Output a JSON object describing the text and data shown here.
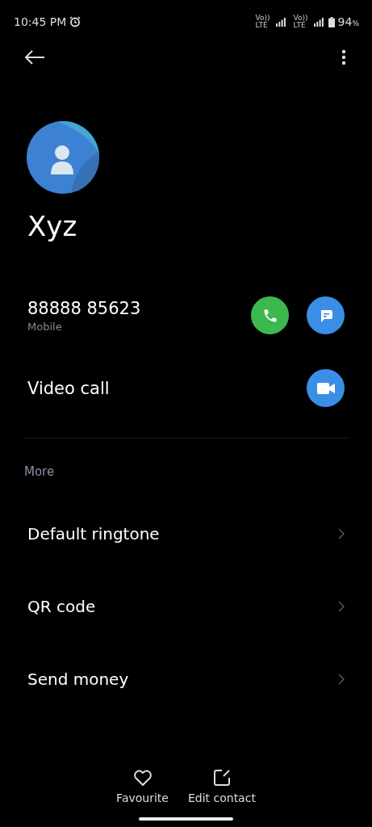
{
  "status_bar": {
    "time": "10:45 PM",
    "battery": "94",
    "battery_unit": "%",
    "sim_labels": [
      {
        "top": "Vo))",
        "bottom": "LTE"
      },
      {
        "top": "Vo))",
        "bottom": "LTE"
      }
    ]
  },
  "contact": {
    "name": "Xyz"
  },
  "phone": {
    "number": "88888 85623",
    "type": "Mobile"
  },
  "video_call": {
    "label": "Video call"
  },
  "section": {
    "title": "More"
  },
  "more_items": [
    {
      "label": "Default ringtone"
    },
    {
      "label": "QR code"
    },
    {
      "label": "Send money"
    }
  ],
  "bottom_actions": [
    {
      "kind": "favourite",
      "label": "Favourite"
    },
    {
      "kind": "edit",
      "label": "Edit contact"
    }
  ]
}
